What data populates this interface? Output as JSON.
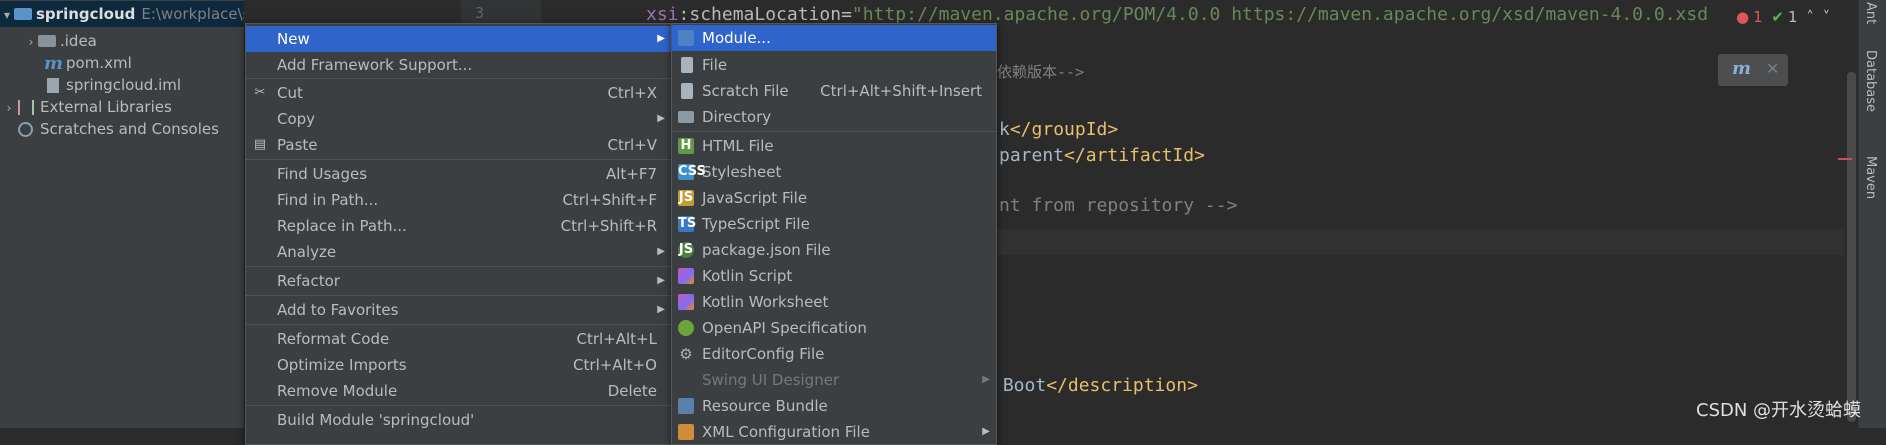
{
  "project_tree": {
    "root": {
      "name": "springcloud",
      "path": "E:\\workplace\\springcloud"
    },
    "items": [
      {
        "label": ".idea"
      },
      {
        "label": "pom.xml"
      },
      {
        "label": "springcloud.iml"
      },
      {
        "label": "External Libraries"
      },
      {
        "label": "Scratches and Consoles"
      }
    ]
  },
  "editor": {
    "line_number": "3",
    "line1": {
      "ns": "xsi",
      "attr": ":schemaLocation",
      "eq": "=",
      "value": "\"http://maven.apache.org/POM/4.0.0 https://maven.apache.org/xsd/maven-4.0.0.xsd"
    },
    "line2_comment": "依赖版本-->",
    "line3": {
      "text": "</groupId>",
      "prefix": "k"
    },
    "line4": {
      "text": "parent",
      "close": "</artifactId>"
    },
    "line5_comment": "nt from repository -->",
    "line6": {
      "text": " Boot",
      "close": "</description>"
    }
  },
  "inspections": {
    "errors": "1",
    "ok": "1"
  },
  "right_bar": {
    "ant": "Ant",
    "database": "Database",
    "maven": "Maven"
  },
  "watermark": "CSDN @开水烫蛤蟆",
  "context_menu": {
    "items": [
      {
        "label": "New",
        "shortcut": ""
      },
      {
        "label": "Add Framework Support...",
        "shortcut": ""
      },
      {
        "label": "Cut",
        "shortcut": "Ctrl+X"
      },
      {
        "label": "Copy",
        "shortcut": ""
      },
      {
        "label": "Paste",
        "shortcut": "Ctrl+V"
      },
      {
        "label": "Find Usages",
        "shortcut": "Alt+F7"
      },
      {
        "label": "Find in Path...",
        "shortcut": "Ctrl+Shift+F"
      },
      {
        "label": "Replace in Path...",
        "shortcut": "Ctrl+Shift+R"
      },
      {
        "label": "Analyze",
        "shortcut": ""
      },
      {
        "label": "Refactor",
        "shortcut": ""
      },
      {
        "label": "Add to Favorites",
        "shortcut": ""
      },
      {
        "label": "Reformat Code",
        "shortcut": "Ctrl+Alt+L"
      },
      {
        "label": "Optimize Imports",
        "shortcut": "Ctrl+Alt+O"
      },
      {
        "label": "Remove Module",
        "shortcut": "Delete"
      },
      {
        "label": "Build Module 'springcloud'",
        "shortcut": ""
      }
    ]
  },
  "new_submenu": {
    "items": [
      {
        "label": "Module...",
        "shortcut": ""
      },
      {
        "label": "File",
        "shortcut": ""
      },
      {
        "label": "Scratch File",
        "shortcut": "Ctrl+Alt+Shift+Insert"
      },
      {
        "label": "Directory",
        "shortcut": ""
      },
      {
        "label": "HTML File",
        "shortcut": ""
      },
      {
        "label": "Stylesheet",
        "shortcut": ""
      },
      {
        "label": "JavaScript File",
        "shortcut": ""
      },
      {
        "label": "TypeScript File",
        "shortcut": ""
      },
      {
        "label": "package.json File",
        "shortcut": ""
      },
      {
        "label": "Kotlin Script",
        "shortcut": ""
      },
      {
        "label": "Kotlin Worksheet",
        "shortcut": ""
      },
      {
        "label": "OpenAPI Specification",
        "shortcut": ""
      },
      {
        "label": "EditorConfig File",
        "shortcut": ""
      },
      {
        "label": "Swing UI Designer",
        "shortcut": ""
      },
      {
        "label": "Resource Bundle",
        "shortcut": ""
      },
      {
        "label": "XML Configuration File",
        "shortcut": ""
      }
    ]
  }
}
